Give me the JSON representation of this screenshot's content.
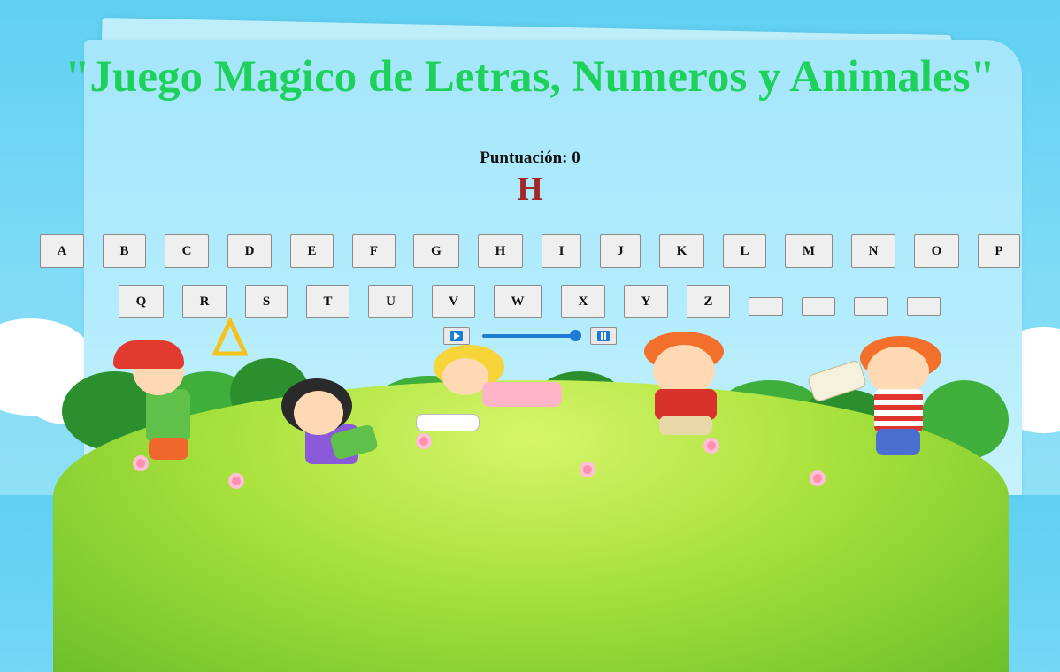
{
  "title": "\"Juego Magico de Letras, Numeros y Animales\"",
  "score": {
    "text": "Puntuación: 0"
  },
  "current_letter": "H",
  "keyboard": {
    "row1": [
      "A",
      "B",
      "C",
      "D",
      "E",
      "F",
      "G",
      "H",
      "I",
      "J",
      "K",
      "L",
      "M",
      "N",
      "O",
      "P"
    ],
    "row2": [
      "Q",
      "R",
      "S",
      "T",
      "U",
      "V",
      "W",
      "X",
      "Y",
      "Z"
    ],
    "blank_keys": 4
  },
  "audio": {
    "progress": 1.0,
    "play_icon": "play-icon",
    "pause_icon": "pause-icon"
  },
  "colors": {
    "title": "#1ed15b",
    "current_letter": "#a3282a",
    "accent": "#1e7bd3"
  }
}
